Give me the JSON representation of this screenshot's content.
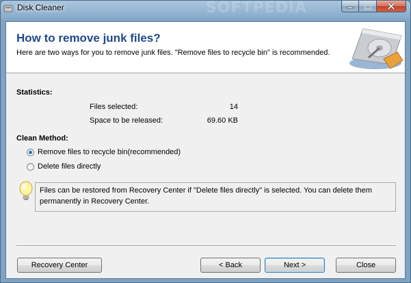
{
  "window": {
    "title": "Disk Cleaner",
    "watermark": "SOFTPEDIA"
  },
  "header": {
    "title": "How to remove junk files?",
    "subtitle": "Here are two ways for you to remove junk files. \"Remove files to recycle bin\" is recommended."
  },
  "statistics": {
    "label": "Statistics:",
    "rows": [
      {
        "name": "Files selected:",
        "value": "14"
      },
      {
        "name": "Space to be released:",
        "value": "69.60 KB"
      }
    ]
  },
  "clean_method": {
    "label": "Clean Method:",
    "options": [
      {
        "label": "Remove files to recycle bin(recommended)",
        "selected": true
      },
      {
        "label": "Delete files directly",
        "selected": false
      }
    ]
  },
  "info": {
    "text": "Files can be restored from Recovery Center if \"Delete files directly\" is selected. You can delete them permanently in Recovery Center."
  },
  "buttons": {
    "recovery_center": "Recovery Center",
    "back": "< Back",
    "next": "Next >",
    "close": "Close"
  },
  "colors": {
    "header_title": "#1f4a8a",
    "radio_dot": "#2a6fc6"
  }
}
